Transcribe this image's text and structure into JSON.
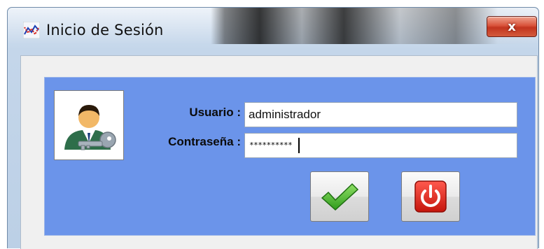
{
  "window": {
    "title": "Inicio de Sesión",
    "close_label": "x"
  },
  "form": {
    "username_label": "Usuario :",
    "username_value": "administrador",
    "password_label": "Contraseña :",
    "password_masked": "**********"
  },
  "icons": {
    "app": "chart-icon",
    "user": "user-key-icon",
    "ok": "checkmark-icon",
    "exit": "power-icon"
  },
  "colors": {
    "panel": "#6b94ea",
    "ok_green": "#4cc02f",
    "exit_red": "#e0241c"
  }
}
